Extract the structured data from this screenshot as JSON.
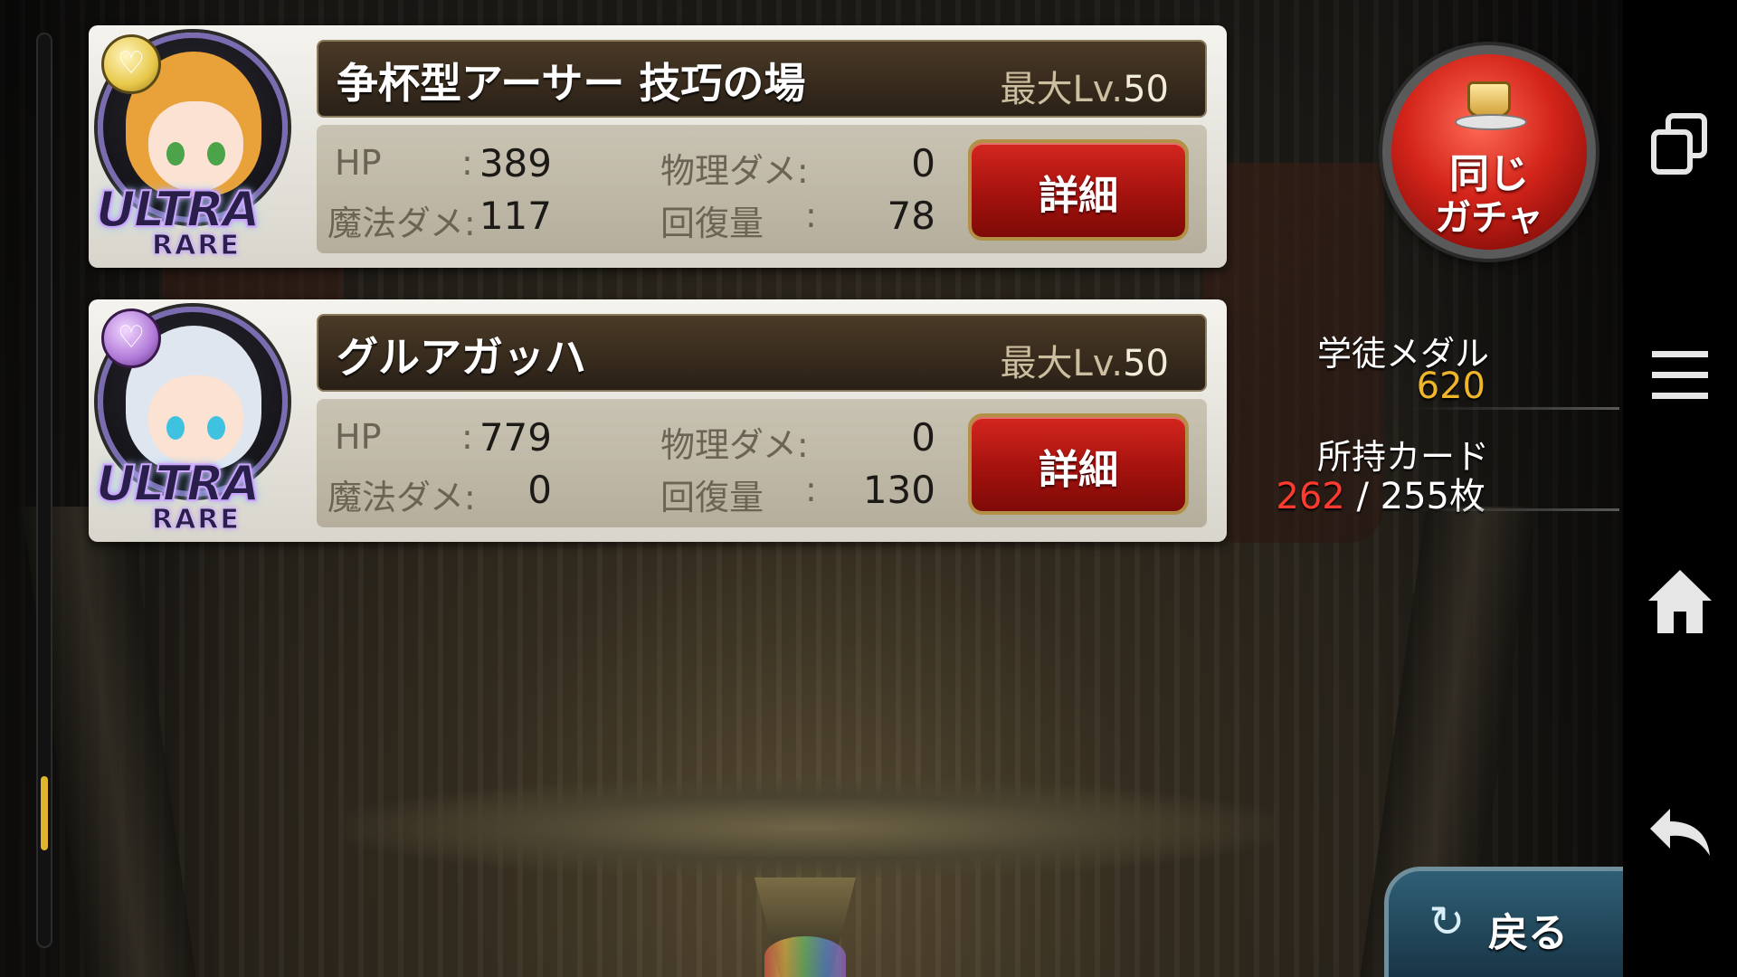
{
  "cards": [
    {
      "name": "争杯型アーサー 技巧の場",
      "max_lv_label": "最大Lv.",
      "max_lv": "50",
      "rarity_top": "ULTRA",
      "rarity_bottom": "RARE",
      "hp_label": "HP",
      "hp": "389",
      "phys_label": "物理ダメ:",
      "phys": "0",
      "magic_label": "魔法ダメ:",
      "magic": "117",
      "heal_label": "回復量",
      "heal": "78",
      "colon": ":",
      "detail_label": "詳細",
      "portrait_hair": "#e9a13a",
      "portrait_eye": "#4ba34a"
    },
    {
      "name": "グルアガッハ",
      "max_lv_label": "最大Lv.",
      "max_lv": "50",
      "rarity_top": "ULTRA",
      "rarity_bottom": "RARE",
      "hp_label": "HP",
      "hp": "779",
      "phys_label": "物理ダメ:",
      "phys": "0",
      "magic_label": "魔法ダメ:",
      "magic": "0",
      "heal_label": "回復量",
      "heal": "130",
      "colon": ":",
      "detail_label": "詳細",
      "portrait_hair": "#dfe6f0",
      "portrait_eye": "#3fc2e0"
    }
  ],
  "gacha": {
    "line1": "同じ",
    "line2": "ガチャ"
  },
  "status": {
    "medal_label": "学徒メダル",
    "medal_value": "620",
    "cards_label": "所持カード",
    "cards_owned": "262",
    "cards_separator": " / ",
    "cards_max": "255枚"
  },
  "back_button": {
    "label": "戻る",
    "icon": "curved-arrow-icon"
  },
  "navbar": {
    "icons": [
      "recent-apps-icon",
      "menu-icon",
      "home-icon",
      "back-icon"
    ]
  },
  "colors": {
    "detail_button": "#c0201a",
    "medal_value": "#f0b62a",
    "cards_owned": "#ff3b30",
    "scroll_thumb": "#e0b52a"
  },
  "scroll": {
    "position_fraction": 0.83
  }
}
